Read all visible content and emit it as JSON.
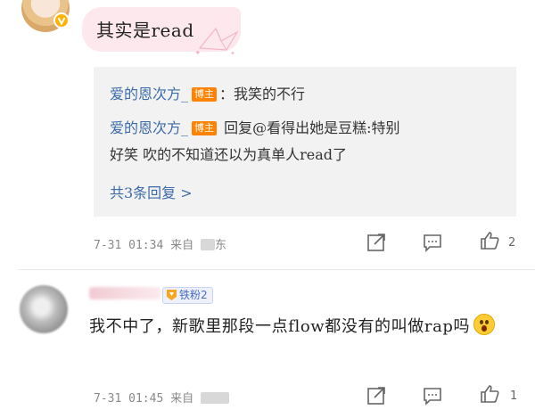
{
  "top_comment": {
    "text": "其实是read"
  },
  "replies": {
    "items": [
      {
        "user": "爱的恩次方_",
        "badge": "博主",
        "text": "：我笑的不行"
      },
      {
        "user": "爱的恩次方_",
        "badge": "博主",
        "text": " 回复@看得出她是豆糕:特别",
        "text_line2": "好笑 吹的不知道还以为真单人read了"
      }
    ],
    "more_label": "共3条回复 >"
  },
  "meta1": {
    "timestamp": "7-31 01:34",
    "from_label": "来自",
    "from_suffix": "东",
    "like_count": "2"
  },
  "comment2": {
    "fan_badge": "铁粉2",
    "text": "我不中了，新歌里那段一点flow都没有的叫做rap吗"
  },
  "meta2": {
    "timestamp": "7-31 01:45",
    "from_label": "来自",
    "like_count": "1"
  },
  "colors": {
    "link": "#3d6aa8",
    "host_badge": "#ff8200",
    "bubble": "#fde8ee",
    "reply_bg": "#f2f2f2"
  },
  "icons": [
    "verified-v-icon",
    "share-icon",
    "comment-icon",
    "like-icon",
    "fan-badge-icon",
    "shocked-emoji-icon"
  ]
}
